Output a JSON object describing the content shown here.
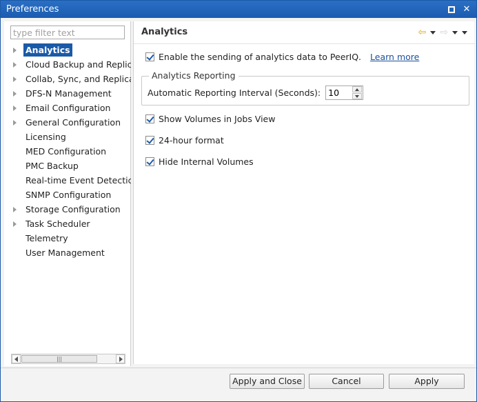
{
  "window": {
    "title": "Preferences"
  },
  "filter": {
    "placeholder": "type filter text",
    "value": ""
  },
  "tree": {
    "items": [
      {
        "label": "Analytics",
        "expandable": true,
        "selected": true
      },
      {
        "label": "Cloud Backup and Replic",
        "expandable": true
      },
      {
        "label": "Collab, Sync, and Replica",
        "expandable": true
      },
      {
        "label": "DFS-N Management",
        "expandable": true
      },
      {
        "label": "Email Configuration",
        "expandable": true
      },
      {
        "label": "General Configuration",
        "expandable": true
      },
      {
        "label": "Licensing",
        "expandable": false
      },
      {
        "label": "MED Configuration",
        "expandable": false
      },
      {
        "label": "PMC Backup",
        "expandable": false
      },
      {
        "label": "Real-time Event Detectic",
        "expandable": false
      },
      {
        "label": "SNMP Configuration",
        "expandable": false
      },
      {
        "label": "Storage Configuration",
        "expandable": true
      },
      {
        "label": "Task Scheduler",
        "expandable": true
      },
      {
        "label": "Telemetry",
        "expandable": false
      },
      {
        "label": "User Management",
        "expandable": false
      }
    ]
  },
  "page": {
    "title": "Analytics",
    "enable_label": "Enable the sending of analytics data to PeerIQ.",
    "learn_more": "Learn more",
    "group_title": "Analytics Reporting",
    "interval_label": "Automatic Reporting Interval (Seconds):",
    "interval_value": "10",
    "show_volumes_label": "Show Volumes in Jobs View",
    "hour_format_label": "24-hour format",
    "hide_internal_label": "Hide Internal Volumes"
  },
  "buttons": {
    "apply_close": "Apply and Close",
    "cancel": "Cancel",
    "apply": "Apply"
  },
  "colors": {
    "titlebar": "#1b5cb0",
    "selection": "#1a5aa8",
    "link": "#1a4f9c",
    "back_arrow": "#e2a51a"
  }
}
